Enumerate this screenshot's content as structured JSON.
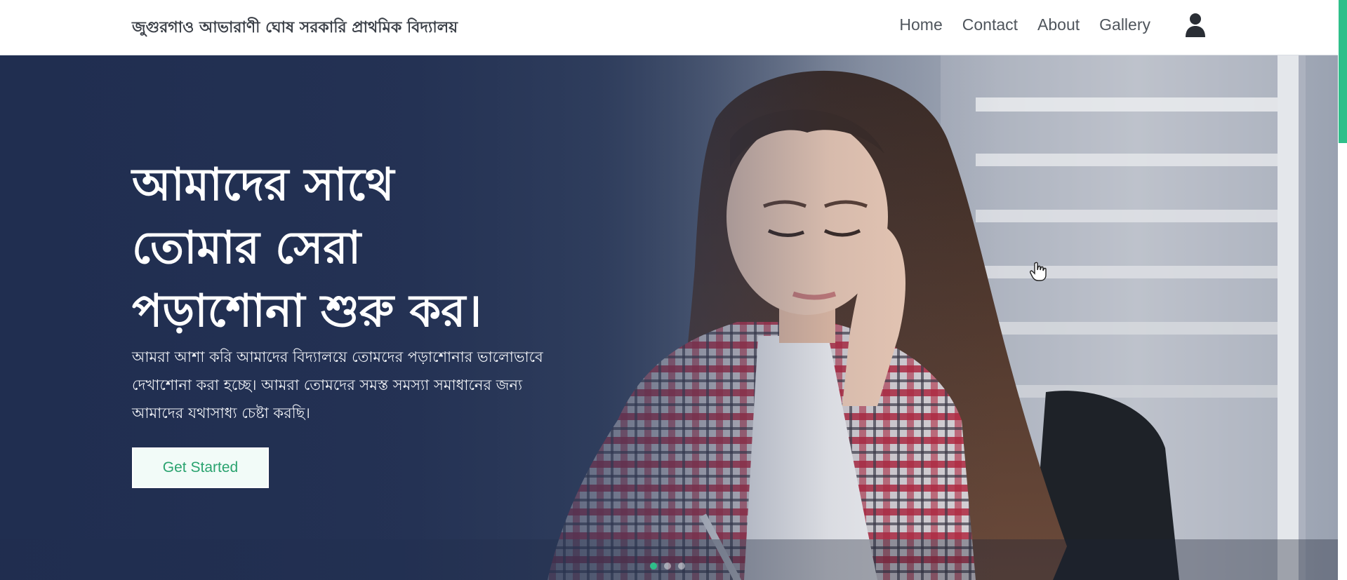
{
  "colors": {
    "accent": "#2fbf8a",
    "hero_overlay": "#1f2d50",
    "nav_text": "#4f555c",
    "brand_text": "#3b4048",
    "cta_text": "#2aa36f"
  },
  "navbar": {
    "brand": "জুগুরগাও আভারাণী ঘোষ সরকারি প্রাথমিক বিদ্যালয়",
    "links": [
      "Home",
      "Contact",
      "About",
      "Gallery"
    ],
    "user_icon": "user-icon"
  },
  "hero": {
    "title_lines": [
      "আমাদের সাথে",
      "তোমার সেরা",
      "পড়াশোনা শুরু কর।"
    ],
    "text_lines": [
      "আমরা আশা করি আমাদের বিদ্যালয়ে তোমদের পড়াশোনার ভালোভাবে",
      "দেখাশোনা করা হচ্ছে। আমরা তোমদের সমস্ত সমস্যা সমাধানের জন্য",
      "আমাদের যথাসাধ্য চেষ্টা করছি।"
    ],
    "cta_label": "Get Started",
    "slides": [
      "slide-1",
      "slide-2",
      "slide-3"
    ],
    "active_slide": 1,
    "image_description_icon": "student-photo"
  }
}
